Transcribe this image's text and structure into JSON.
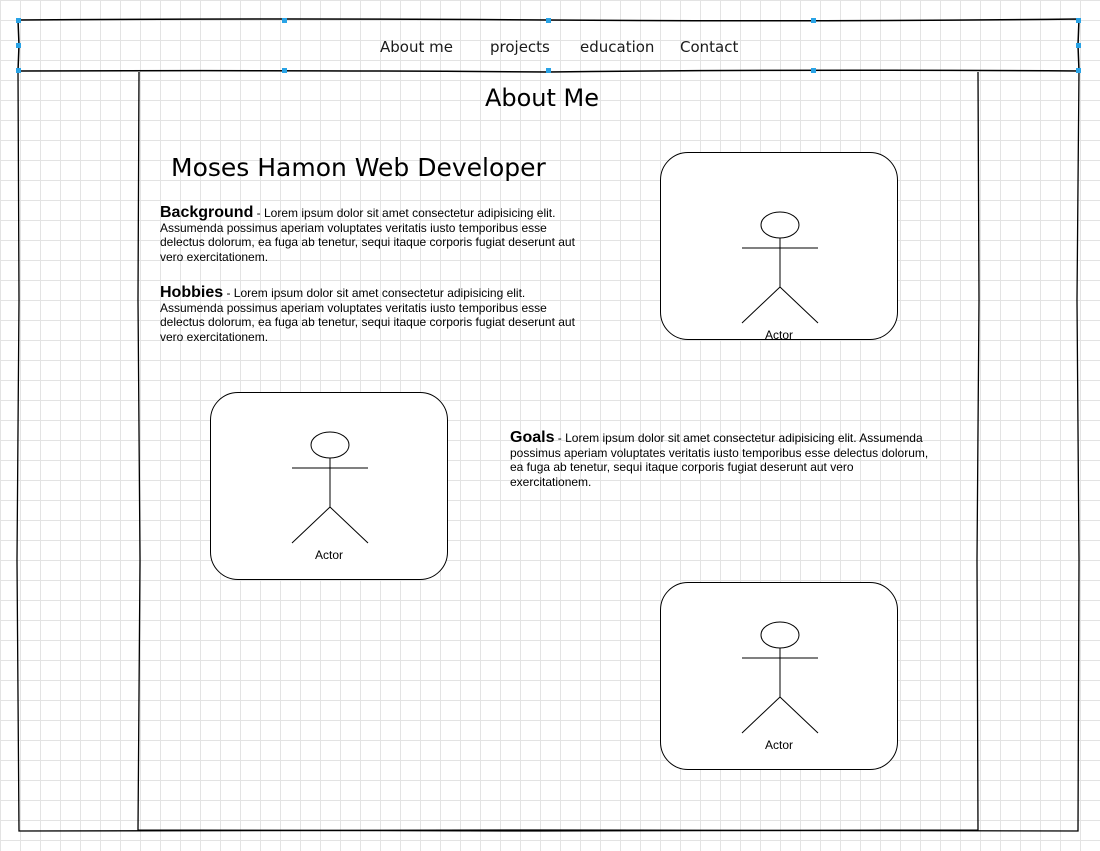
{
  "nav": {
    "items": [
      {
        "label": "About me"
      },
      {
        "label": "projects"
      },
      {
        "label": "education"
      },
      {
        "label": "Contact"
      }
    ]
  },
  "main": {
    "page_title": "About Me",
    "hero_title": "Moses Hamon Web Developer",
    "sections": [
      {
        "heading": "Background",
        "text": " - Lorem ipsum dolor sit amet consectetur adipisicing elit. Assumenda possimus aperiam voluptates veritatis iusto temporibus esse delectus dolorum, ea fuga ab tenetur, sequi itaque corporis fugiat deserunt aut vero exercitationem."
      },
      {
        "heading": "Hobbies",
        "text": " - Lorem ipsum dolor sit amet consectetur adipisicing elit. Assumenda possimus aperiam voluptates veritatis iusto temporibus esse delectus dolorum, ea fuga ab tenetur, sequi itaque corporis fugiat deserunt aut vero exercitationem."
      },
      {
        "heading": "Goals",
        "text": " - Lorem ipsum dolor sit amet consectetur adipisicing elit. Assumenda possimus aperiam voluptates veritatis iusto temporibus esse delectus dolorum, ea fuga ab tenetur, sequi itaque corporis fugiat deserunt aut vero exercitationem."
      }
    ],
    "images": [
      {
        "caption": "Actor"
      },
      {
        "caption": "Actor"
      },
      {
        "caption": "Actor"
      }
    ]
  }
}
